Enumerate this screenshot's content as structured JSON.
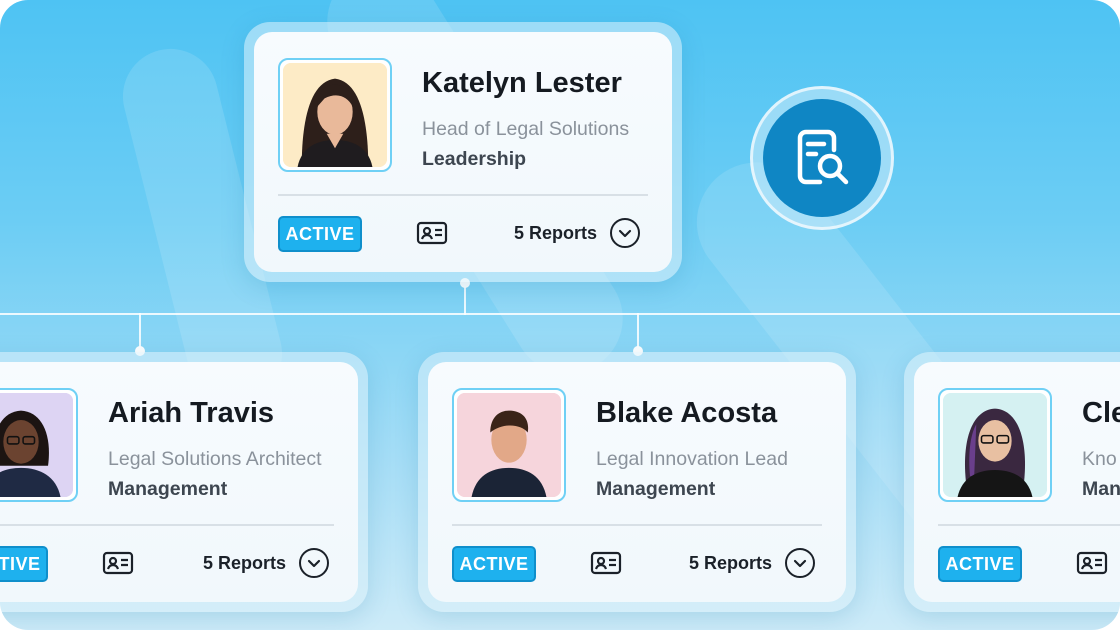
{
  "manager": {
    "name": "Katelyn Lester",
    "role": "Head of Legal Solutions",
    "department": "Leadership",
    "status": "ACTIVE",
    "reports": "5 Reports",
    "avatar_bg": "#fdebc6"
  },
  "reports_row": [
    {
      "name": "Ariah Travis",
      "role": "Legal Solutions Architect",
      "department": "Management",
      "status": "ACTIVE",
      "reports": "5 Reports",
      "avatar_bg": "#ddd4f3"
    },
    {
      "name": "Blake Acosta",
      "role": "Legal Innovation Lead",
      "department": "Management",
      "status": "ACTIVE",
      "reports": "5 Reports",
      "avatar_bg": "#f6d5dc"
    },
    {
      "name": "Cle",
      "role": "Kno",
      "department": "Man",
      "status": "ACTIVE",
      "avatar_bg": "#d5f1f2"
    }
  ],
  "icons": {
    "search_document": "document-search-icon",
    "contact_card": "id-card-icon",
    "expand": "chevron-down-circle-icon"
  },
  "colors": {
    "accent": "#1eb1ee",
    "search_bubble": "#0f86c4",
    "background_top": "#4ec3f3"
  }
}
